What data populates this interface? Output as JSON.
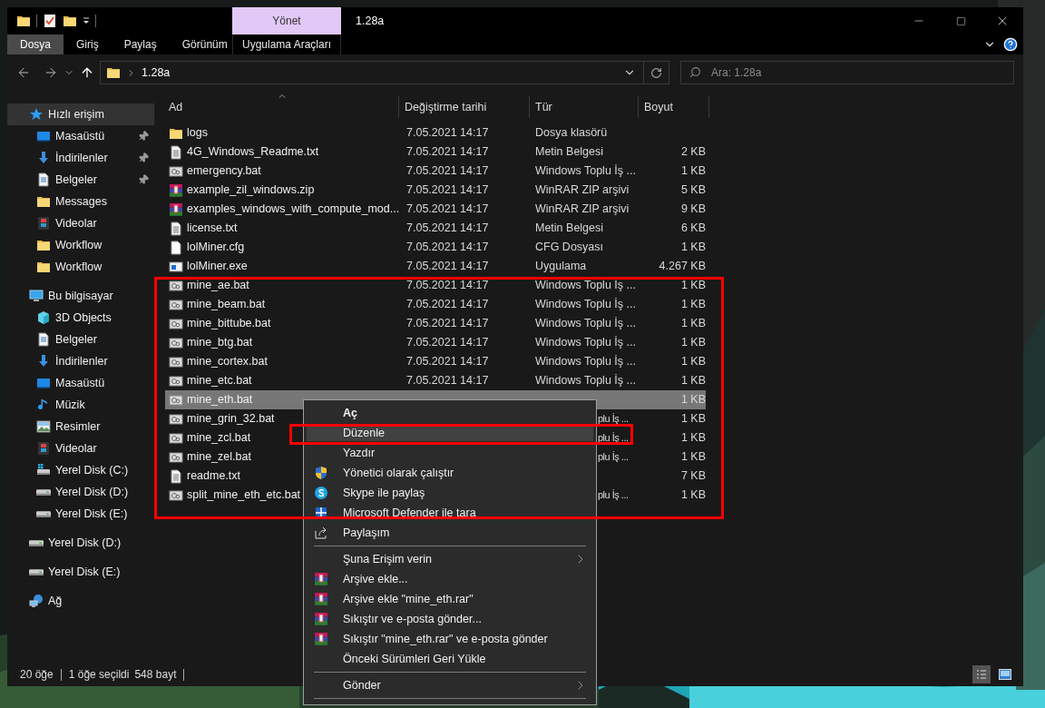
{
  "window": {
    "title": "1.28a"
  },
  "ribbon": {
    "context_tab": {
      "label": "Yönet"
    },
    "tabs": [
      {
        "label": "Dosya",
        "selected": true,
        "kind": "main"
      },
      {
        "label": "Giriş",
        "selected": false,
        "kind": "main"
      },
      {
        "label": "Paylaş",
        "selected": false,
        "kind": "main"
      },
      {
        "label": "Görünüm",
        "selected": false,
        "kind": "main"
      },
      {
        "label": "Uygulama Araçları",
        "selected": false,
        "kind": "context"
      }
    ]
  },
  "address_bar": {
    "path": "1.28a"
  },
  "search": {
    "placeholder": "Ara: 1.28a"
  },
  "sidebar": {
    "items": [
      {
        "label": "Hızlı erişim",
        "kind": "star",
        "selected": true,
        "children": [
          {
            "label": "Masaüstü",
            "kind": "desktop",
            "selected": false,
            "pinned": true
          },
          {
            "label": "İndirilenler",
            "kind": "download",
            "selected": false,
            "pinned": true
          },
          {
            "label": "Belgeler",
            "kind": "document",
            "selected": false,
            "pinned": true
          },
          {
            "label": "Messages",
            "kind": "folder",
            "selected": false,
            "pinned": false
          },
          {
            "label": "Videolar",
            "kind": "video",
            "selected": false,
            "pinned": false
          },
          {
            "label": "Workflow",
            "kind": "folder",
            "selected": false,
            "pinned": false
          },
          {
            "label": "Workflow",
            "kind": "folder",
            "selected": false,
            "pinned": false
          }
        ]
      },
      {
        "label": "Bu bilgisayar",
        "kind": "computer",
        "selected": false,
        "children": [
          {
            "label": "3D Objects",
            "kind": "cube",
            "selected": false,
            "pinned": false
          },
          {
            "label": "Belgeler",
            "kind": "document",
            "selected": false,
            "pinned": false
          },
          {
            "label": "İndirilenler",
            "kind": "download",
            "selected": false,
            "pinned": false
          },
          {
            "label": "Masaüstü",
            "kind": "desktop",
            "selected": false,
            "pinned": false
          },
          {
            "label": "Müzik",
            "kind": "music",
            "selected": false,
            "pinned": false
          },
          {
            "label": "Resimler",
            "kind": "pictures",
            "selected": false,
            "pinned": false
          },
          {
            "label": "Videolar",
            "kind": "video",
            "selected": false,
            "pinned": false
          },
          {
            "label": "Yerel Disk (C:)",
            "kind": "system-disk",
            "selected": false,
            "pinned": false
          },
          {
            "label": "Yerel Disk (D:)",
            "kind": "disk",
            "selected": false,
            "pinned": false
          },
          {
            "label": "Yerel Disk (E:)",
            "kind": "disk",
            "selected": false,
            "pinned": false
          }
        ]
      },
      {
        "label": "Yerel Disk (D:)",
        "kind": "disk",
        "selected": false
      },
      {
        "label": "Yerel Disk (E:)",
        "kind": "disk",
        "selected": false
      },
      {
        "label": "Ağ",
        "kind": "network",
        "selected": false
      }
    ]
  },
  "table": {
    "columns": [
      {
        "label": "Ad",
        "sorted": true
      },
      {
        "label": "Değiştirme tarihi",
        "sorted": false
      },
      {
        "label": "Tür",
        "sorted": false
      },
      {
        "label": "Boyut",
        "sorted": false
      }
    ],
    "rows": [
      {
        "name": "logs",
        "kind": "folder",
        "date": "7.05.2021 14:17",
        "type": "Dosya klasörü",
        "selected": false
      },
      {
        "name": "4G_Windows_Readme.txt",
        "kind": "text",
        "date": "7.05.2021 14:17",
        "type": "Metin Belgesi",
        "size": "2 KB",
        "selected": false
      },
      {
        "name": "emergency.bat",
        "kind": "bat",
        "date": "7.05.2021 14:17",
        "type": "Windows Toplu İş ...",
        "size": "1 KB",
        "selected": false
      },
      {
        "name": "example_zil_windows.zip",
        "kind": "zip",
        "date": "7.05.2021 14:17",
        "type": "WinRAR ZIP arşivi",
        "size": "5 KB",
        "selected": false
      },
      {
        "name": "examples_windows_with_compute_mod...",
        "kind": "zip",
        "date": "7.05.2021 14:17",
        "type": "WinRAR ZIP arşivi",
        "size": "9 KB",
        "selected": false
      },
      {
        "name": "license.txt",
        "kind": "text",
        "date": "7.05.2021 14:17",
        "type": "Metin Belgesi",
        "size": "6 KB",
        "selected": false
      },
      {
        "name": "lolMiner.cfg",
        "kind": "blank",
        "date": "7.05.2021 14:17",
        "type": "CFG Dosyası",
        "size": "1 KB",
        "selected": false
      },
      {
        "name": "lolMiner.exe",
        "kind": "exe",
        "date": "7.05.2021 14:17",
        "type": "Uygulama",
        "size": "4.267 KB",
        "selected": false
      },
      {
        "name": "mine_ae.bat",
        "kind": "bat",
        "date": "7.05.2021 14:17",
        "type": "Windows Toplu İş ...",
        "size": "1 KB",
        "selected": false
      },
      {
        "name": "mine_beam.bat",
        "kind": "bat",
        "date": "7.05.2021 14:17",
        "type": "Windows Toplu İş ...",
        "size": "1 KB",
        "selected": false
      },
      {
        "name": "mine_bittube.bat",
        "kind": "bat",
        "date": "7.05.2021 14:17",
        "type": "Windows Toplu İş ...",
        "size": "1 KB",
        "selected": false
      },
      {
        "name": "mine_btg.bat",
        "kind": "bat",
        "date": "7.05.2021 14:17",
        "type": "Windows Toplu İş ...",
        "size": "1 KB",
        "selected": false
      },
      {
        "name": "mine_cortex.bat",
        "kind": "bat",
        "date": "7.05.2021 14:17",
        "type": "Windows Toplu İş ...",
        "size": "1 KB",
        "selected": false
      },
      {
        "name": "mine_etc.bat",
        "kind": "bat",
        "date": "7.05.2021 14:17",
        "type": "Windows Toplu İş ...",
        "size": "1 KB",
        "selected": false
      },
      {
        "name": "mine_eth.bat",
        "kind": "bat",
        "size": "1 KB",
        "selected": true
      },
      {
        "name": "mine_grin_32.bat",
        "kind": "bat",
        "type": "plu İş ...",
        "size": "1 KB",
        "selected": false
      },
      {
        "name": "mine_zcl.bat",
        "kind": "bat",
        "type": "plu İş ...",
        "size": "1 KB",
        "selected": false
      },
      {
        "name": "mine_zel.bat",
        "kind": "bat",
        "type": "plu İş ...",
        "size": "1 KB",
        "selected": false
      },
      {
        "name": "readme.txt",
        "kind": "text",
        "size": "7 KB",
        "selected": false
      },
      {
        "name": "split_mine_eth_etc.bat",
        "kind": "bat",
        "type": "plu İş ...",
        "size": "1 KB",
        "selected": false
      }
    ]
  },
  "context_menu": {
    "items": [
      {
        "kind": "item",
        "label": "Aç",
        "bold": true,
        "highlighted": false,
        "submenu": false
      },
      {
        "kind": "item",
        "label": "Düzenle",
        "bold": false,
        "highlighted": true,
        "submenu": false
      },
      {
        "kind": "item",
        "label": "Yazdır",
        "bold": false,
        "highlighted": false,
        "submenu": false
      },
      {
        "kind": "item",
        "label": "Yönetici olarak çalıştır",
        "bold": false,
        "highlighted": false,
        "submenu": false
      },
      {
        "kind": "item",
        "label": "Skype ile paylaş",
        "bold": false,
        "highlighted": false,
        "submenu": false
      },
      {
        "kind": "item",
        "label": "Microsoft Defender ile tara",
        "bold": false,
        "highlighted": false,
        "submenu": false
      },
      {
        "kind": "item",
        "label": "Paylaşım",
        "bold": false,
        "highlighted": false,
        "submenu": false
      },
      {
        "kind": "separator"
      },
      {
        "kind": "item",
        "label": "Şuna Erişim verin",
        "bold": false,
        "highlighted": false,
        "submenu": true
      },
      {
        "kind": "item",
        "label": "Arşive ekle...",
        "bold": false,
        "highlighted": false,
        "submenu": false
      },
      {
        "kind": "item",
        "label": "Arşive ekle \"mine_eth.rar\"",
        "bold": false,
        "highlighted": false,
        "submenu": false
      },
      {
        "kind": "item",
        "label": "Sıkıştır ve e-posta gönder...",
        "bold": false,
        "highlighted": false,
        "submenu": false
      },
      {
        "kind": "item",
        "label": "Sıkıştır \"mine_eth.rar\" ve e-posta gönder",
        "bold": false,
        "highlighted": false,
        "submenu": false
      },
      {
        "kind": "item",
        "label": "Önceki Sürümleri Geri Yükle",
        "bold": false,
        "highlighted": false,
        "submenu": false
      },
      {
        "kind": "separator"
      },
      {
        "kind": "item",
        "label": "Gönder",
        "bold": false,
        "highlighted": false,
        "submenu": true
      },
      {
        "kind": "separator"
      }
    ]
  },
  "status_bar": {
    "item_count": "20 öğe",
    "selection": "1 öğe seçildi",
    "selection_size": "548 bayt"
  },
  "annotations": [
    {
      "kind": "frame",
      "color": "#ff0000"
    },
    {
      "kind": "frame",
      "color": "#ff0000"
    }
  ]
}
